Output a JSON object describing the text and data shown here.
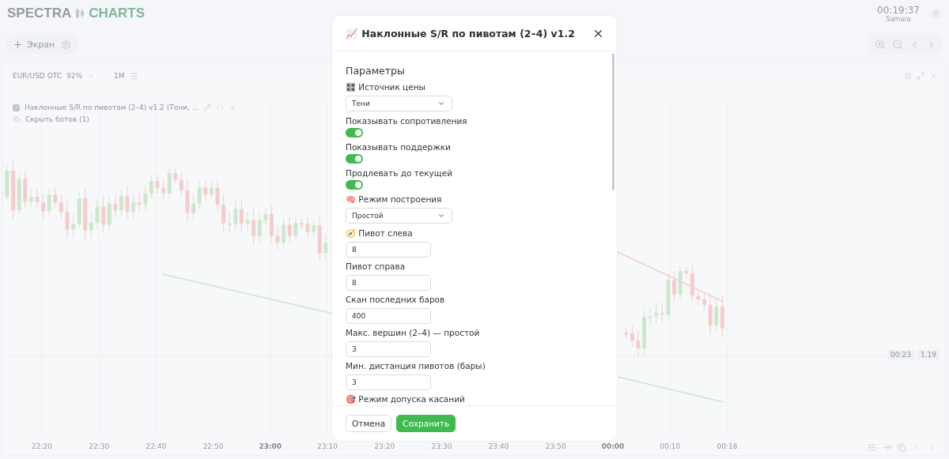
{
  "header": {
    "logo_left": "SPECTRA",
    "logo_right": "CHARTS",
    "clock": "00:19:37",
    "timezone": "Samara"
  },
  "toolbar": {
    "add_screen": "Экран"
  },
  "chart_panel": {
    "symbol": "EUR/USD OTC",
    "payout": "92%",
    "timeframe": "1M",
    "indicator": {
      "checked": true,
      "label": "Наклонные S/R по пивотам (2–4) v1.2 (Тени, ..."
    },
    "bots": "Скрыть ботов (1)",
    "price_tag": {
      "time": "00:23",
      "price": "1.19"
    },
    "time_axis": [
      {
        "label": "22:20",
        "bold": false
      },
      {
        "label": "22:30",
        "bold": false
      },
      {
        "label": "22:40",
        "bold": false
      },
      {
        "label": "22:50",
        "bold": false
      },
      {
        "label": "23:00",
        "bold": true
      },
      {
        "label": "23:10",
        "bold": false
      },
      {
        "label": "23:20",
        "bold": false
      },
      {
        "label": "23:30",
        "bold": false
      },
      {
        "label": "23:40",
        "bold": false
      },
      {
        "label": "23:50",
        "bold": false
      },
      {
        "label": "00:00",
        "bold": true
      },
      {
        "label": "00:10",
        "bold": false
      },
      {
        "label": "00:18",
        "bold": false
      }
    ]
  },
  "modal": {
    "title": "📈 Наклонные S/R по пивотам (2–4) v1.2",
    "section": "Параметры",
    "fields": [
      {
        "kind": "select",
        "label": "🎛️ Источник цены",
        "value": "Тени"
      },
      {
        "kind": "toggle",
        "label": "Показывать сопротивления",
        "on": true
      },
      {
        "kind": "toggle",
        "label": "Показывать поддержки",
        "on": true
      },
      {
        "kind": "toggle",
        "label": "Продлевать до текущей",
        "on": true
      },
      {
        "kind": "select",
        "label": "🧠 Режим построения",
        "value": "Простой"
      },
      {
        "kind": "number",
        "label": "🧭 Пивот слева",
        "value": "8"
      },
      {
        "kind": "number",
        "label": "Пивот справа",
        "value": "8"
      },
      {
        "kind": "number",
        "label": "Скан последних баров",
        "value": "400"
      },
      {
        "kind": "number",
        "label": "Макс. вершин (2–4) — простой",
        "value": "3"
      },
      {
        "kind": "number",
        "label": "Мин. дистанция пивотов (бары)",
        "value": "3"
      },
      {
        "kind": "heading",
        "label": "🎯 Режим допуска касаний"
      }
    ],
    "cancel": "Отмена",
    "save": "Сохранить"
  }
}
